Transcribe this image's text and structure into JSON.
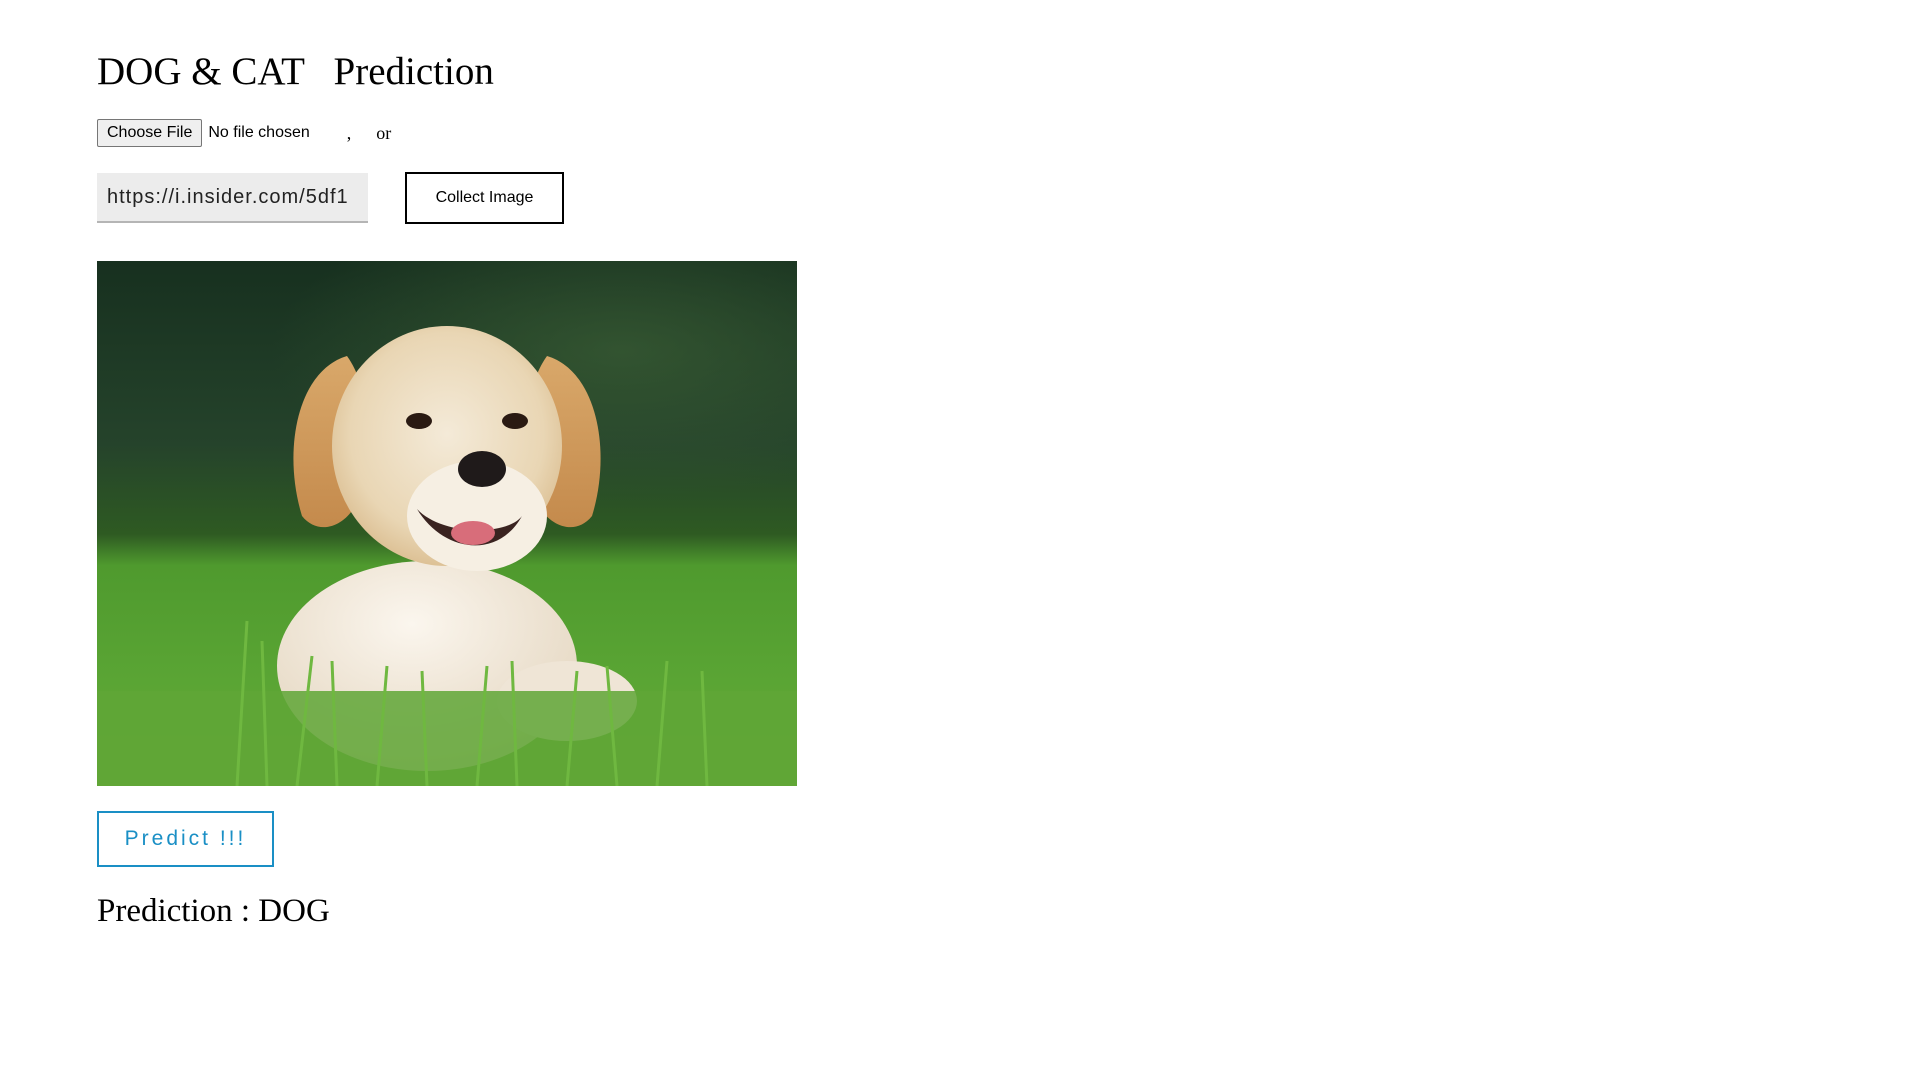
{
  "page": {
    "title": "DOG & CAT   Prediction"
  },
  "upload": {
    "choose_file_label": "Choose File",
    "file_status": "No file chosen",
    "separator": ",",
    "or_text": "or"
  },
  "url_form": {
    "url_value": "https://i.insider.com/5df1",
    "collect_label": "Collect Image"
  },
  "image": {
    "subject": "golden retriever puppy lying in grass",
    "icon": "dog-photo"
  },
  "predict": {
    "button_label": "Predict !!!"
  },
  "result": {
    "text": "Prediction : DOG"
  },
  "colors": {
    "accent": "#1a8fc5",
    "input_bg": "#ececec"
  }
}
